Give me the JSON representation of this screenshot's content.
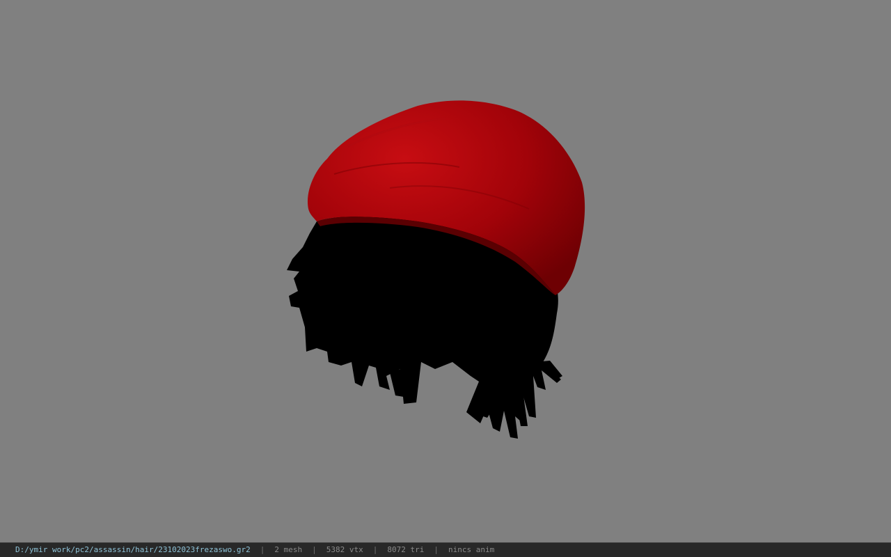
{
  "viewport": {
    "background_color": "#808080",
    "model_name": "hair-with-red-cap-model",
    "colors": {
      "cap": "#8f0006",
      "cap_highlight": "#c70d12",
      "hair": "#000000"
    }
  },
  "statusbar": {
    "file_path": "D:/ymir work/pc2/assassin/hair/23102023frezaswo.gr2",
    "separator": "|",
    "mesh_count": "2 mesh",
    "vertex_count": "5382 vtx",
    "triangle_count": "8072 tri",
    "anim_status": "nincs anim"
  }
}
